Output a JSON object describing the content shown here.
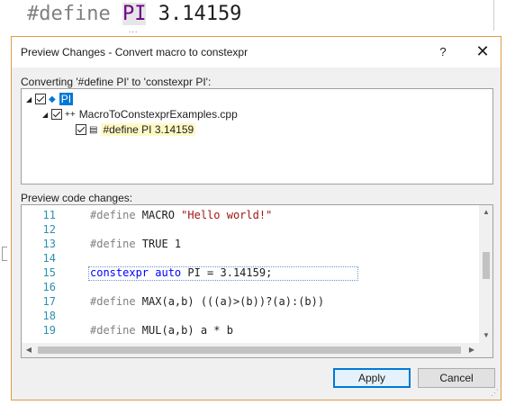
{
  "editor": {
    "code_prefix": "#define ",
    "code_symbol": "PI",
    "code_value": " 3.14159",
    "dots": "..."
  },
  "dialog": {
    "title": "Preview Changes - Convert macro to constexpr",
    "help_label": "?",
    "close_label": "✕",
    "converting_label": "Converting '#define PI' to 'constexpr PI':",
    "tree": {
      "root_label": "PI",
      "file_label": "MacroToConstexprExamples.cpp",
      "change_label": "#define PI 3.14159"
    },
    "preview_label": "Preview code changes:",
    "code_lines": [
      {
        "num": "11",
        "pre": "#define",
        "rest": " MACRO ",
        "str": "\"Hello world!\"",
        "kw": "",
        "plain": ""
      },
      {
        "num": "12",
        "pre": "",
        "rest": "",
        "str": "",
        "kw": "",
        "plain": ""
      },
      {
        "num": "13",
        "pre": "#define",
        "rest": " TRUE 1",
        "str": "",
        "kw": "",
        "plain": ""
      },
      {
        "num": "14",
        "pre": "",
        "rest": "",
        "str": "",
        "kw": "",
        "plain": ""
      },
      {
        "num": "15",
        "pre": "",
        "rest": "",
        "str": "",
        "kw": "constexpr auto",
        "plain": " PI = 3.14159;"
      },
      {
        "num": "16",
        "pre": "",
        "rest": "",
        "str": "",
        "kw": "",
        "plain": ""
      },
      {
        "num": "17",
        "pre": "#define",
        "rest": " MAX(a,b) (((a)>(b))?(a):(b))",
        "str": "",
        "kw": "",
        "plain": ""
      },
      {
        "num": "18",
        "pre": "",
        "rest": "",
        "str": "",
        "kw": "",
        "plain": ""
      },
      {
        "num": "19",
        "pre": "#define",
        "rest": " MUL(a,b) a * b",
        "str": "",
        "kw": "",
        "plain": ""
      }
    ],
    "apply_label": "Apply",
    "cancel_label": "Cancel"
  },
  "colors": {
    "accent": "#0078d7",
    "dialog_border": "#e09a4b",
    "line_number": "#2b91af",
    "keyword": "#0000ff",
    "string": "#a31515"
  }
}
